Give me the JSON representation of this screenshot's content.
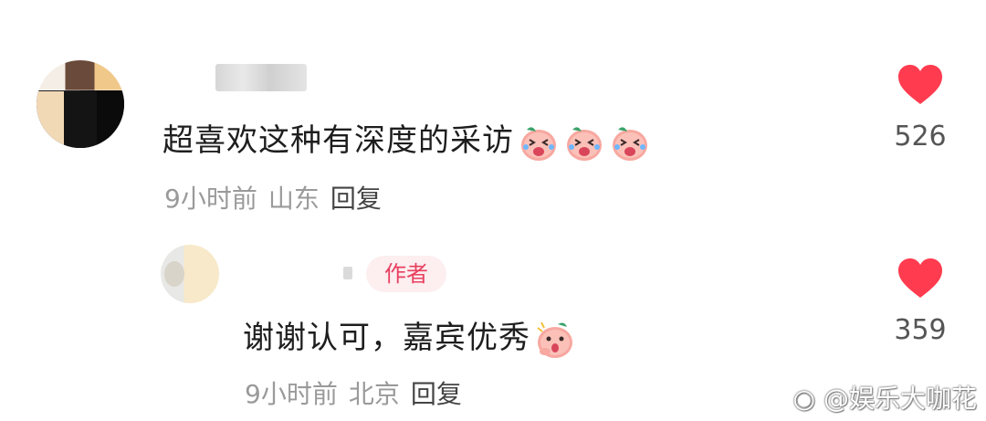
{
  "comments": [
    {
      "text": "超喜欢这种有深度的采访",
      "emojis": [
        "crying-pig-emoji",
        "crying-pig-emoji",
        "crying-pig-emoji"
      ],
      "time": "9小时前",
      "location": "山东",
      "reply_label": "回复",
      "likes": "526"
    }
  ],
  "reply": {
    "badge": "作者",
    "text": "谢谢认可，嘉宾优秀",
    "emojis": [
      "shocked-pig-emoji"
    ],
    "time": "9小时前",
    "location": "北京",
    "reply_label": "回复",
    "likes": "359"
  },
  "watermark": "@娱乐大咖花",
  "colors": {
    "heart": "#ff3b4f",
    "badge_text": "#e8405f",
    "badge_bg": "#fdeef0"
  }
}
